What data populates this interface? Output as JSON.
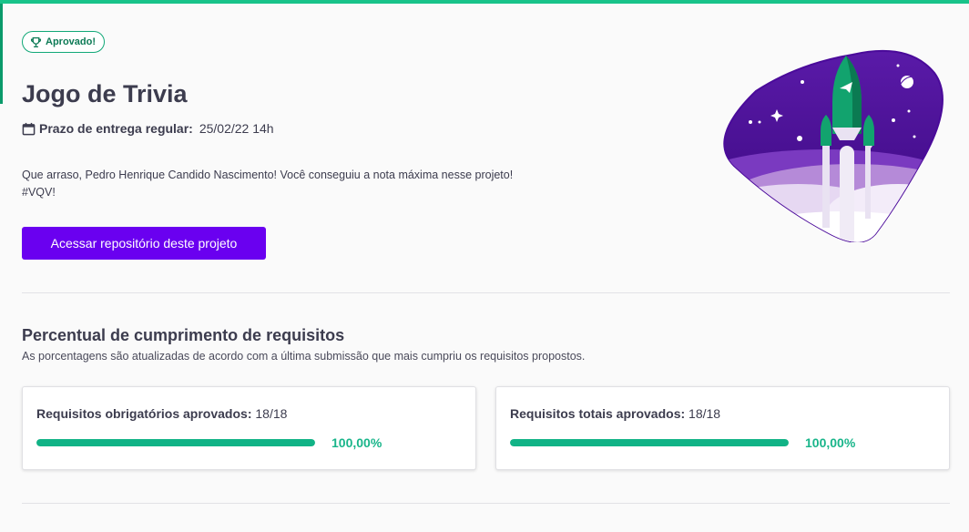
{
  "badge": {
    "label": "Aprovado!",
    "icon": "trophy-icon"
  },
  "project": {
    "title": "Jogo de Trivia",
    "deadline_label": "Prazo de entrega regular:",
    "deadline_value": "25/02/22 14h",
    "message_line1": "Que arraso, Pedro Henrique Candido Nascimento! Você conseguiu a nota máxima nesse projeto!",
    "message_line2": "#VQV!",
    "repo_button": "Acessar repositório deste projeto"
  },
  "requirements": {
    "title": "Percentual de cumprimento de requisitos",
    "subtitle": "As porcentagens são atualizadas de acordo com a última submissão que mais cumpriu os requisitos propostos.",
    "cards": [
      {
        "label": "Requisitos obrigatórios aprovados:",
        "count": "18/18",
        "progress": 1.0,
        "percent": "100,00%"
      },
      {
        "label": "Requisitos totais aprovados:",
        "count": "18/18",
        "progress": 1.0,
        "percent": "100,00%"
      }
    ]
  },
  "colors": {
    "accent_green": "#19c38a",
    "primary_purple": "#6a00f0",
    "progress_green": "#11b386"
  }
}
